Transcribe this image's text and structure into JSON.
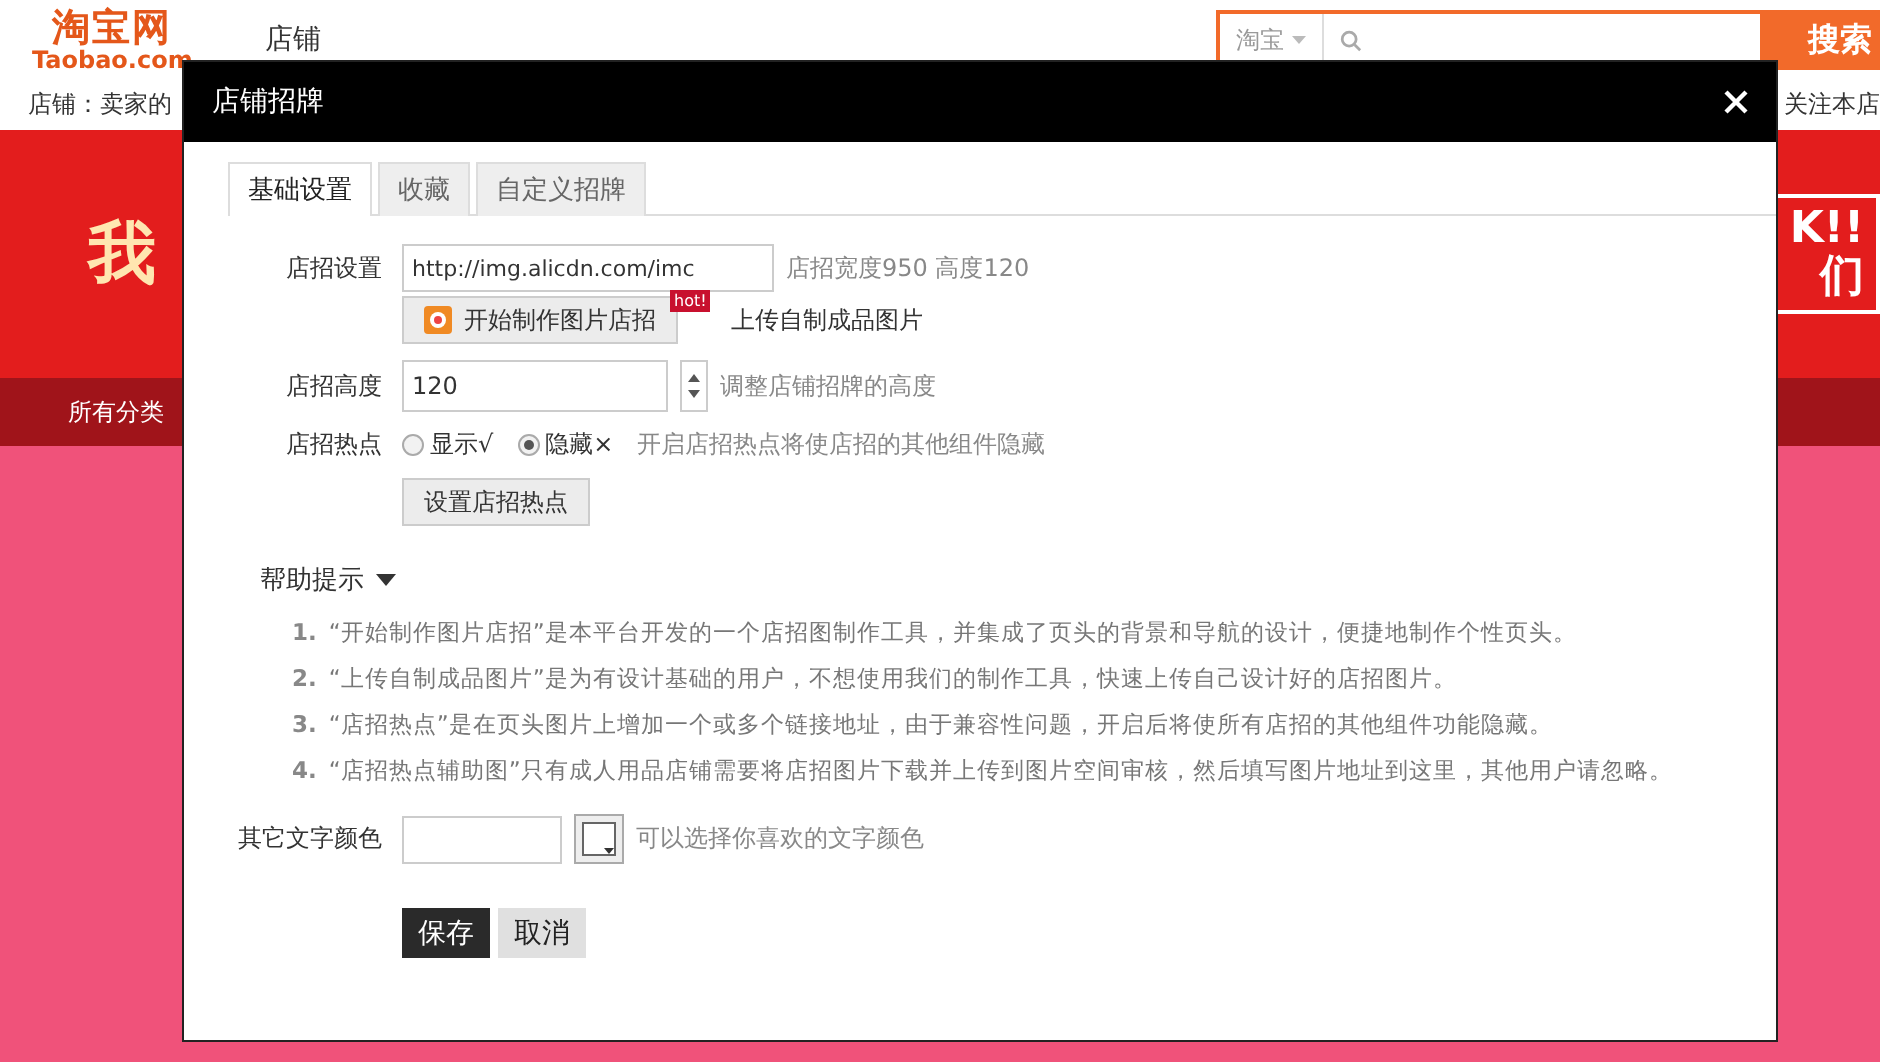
{
  "page": {
    "logo_cn": "淘宝网",
    "logo_en": "Taobao.com",
    "nav_title": "店铺",
    "search_scope": "淘宝",
    "search_button": "搜索",
    "shop_label": "店铺：",
    "shop_name": "卖家的",
    "follow": "关注本店",
    "banner_left": "我",
    "banner_right_top": "K!!",
    "banner_right_bottom": "们",
    "category": "所有分类"
  },
  "dialog": {
    "title": "店铺招牌",
    "tabs": [
      {
        "label": "基础设置",
        "selected": true
      },
      {
        "label": "收藏",
        "selected": false
      },
      {
        "label": "自定义招牌",
        "selected": false
      }
    ],
    "sign": {
      "label": "店招设置",
      "value": "http://img.alicdn.com/imc",
      "hint": "店招宽度950 高度120",
      "make_button": "开始制作图片店招",
      "hot_badge": "hot!",
      "upload_link": "上传自制成品图片"
    },
    "height": {
      "label": "店招高度",
      "value": "120",
      "hint": "调整店铺招牌的高度"
    },
    "hotspot": {
      "label": "店招热点",
      "options": [
        {
          "label": "显示√",
          "selected": false
        },
        {
          "label": "隐藏×",
          "selected": true
        }
      ],
      "hint": "开启店招热点将使店招的其他组件隐藏",
      "button": "设置店招热点"
    },
    "help": {
      "title": "帮助提示",
      "expanded": true,
      "items": [
        {
          "num": "1.",
          "text": "“开始制作图片店招”是本平台开发的一个店招图制作工具，并集成了页头的背景和导航的设计，便捷地制作个性页头。"
        },
        {
          "num": "2.",
          "text": "“上传自制成品图片”是为有设计基础的用户，不想使用我们的制作工具，快速上传自己设计好的店招图片。"
        },
        {
          "num": "3.",
          "text": "“店招热点”是在页头图片上增加一个或多个链接地址，由于兼容性问题，开启后将使所有店招的其他组件功能隐藏。"
        },
        {
          "num": "4.",
          "text": "“店招热点辅助图”只有成人用品店铺需要将店招图片下载并上传到图片空间审核，然后填写图片地址到这里，其他用户请忽略。"
        }
      ]
    },
    "color": {
      "label": "其它文字颜色",
      "hint": "可以选择你喜欢的文字颜色"
    },
    "buttons": [
      {
        "kind": "primary",
        "label": "保存"
      },
      {
        "kind": "secondary",
        "label": "取消"
      }
    ]
  }
}
